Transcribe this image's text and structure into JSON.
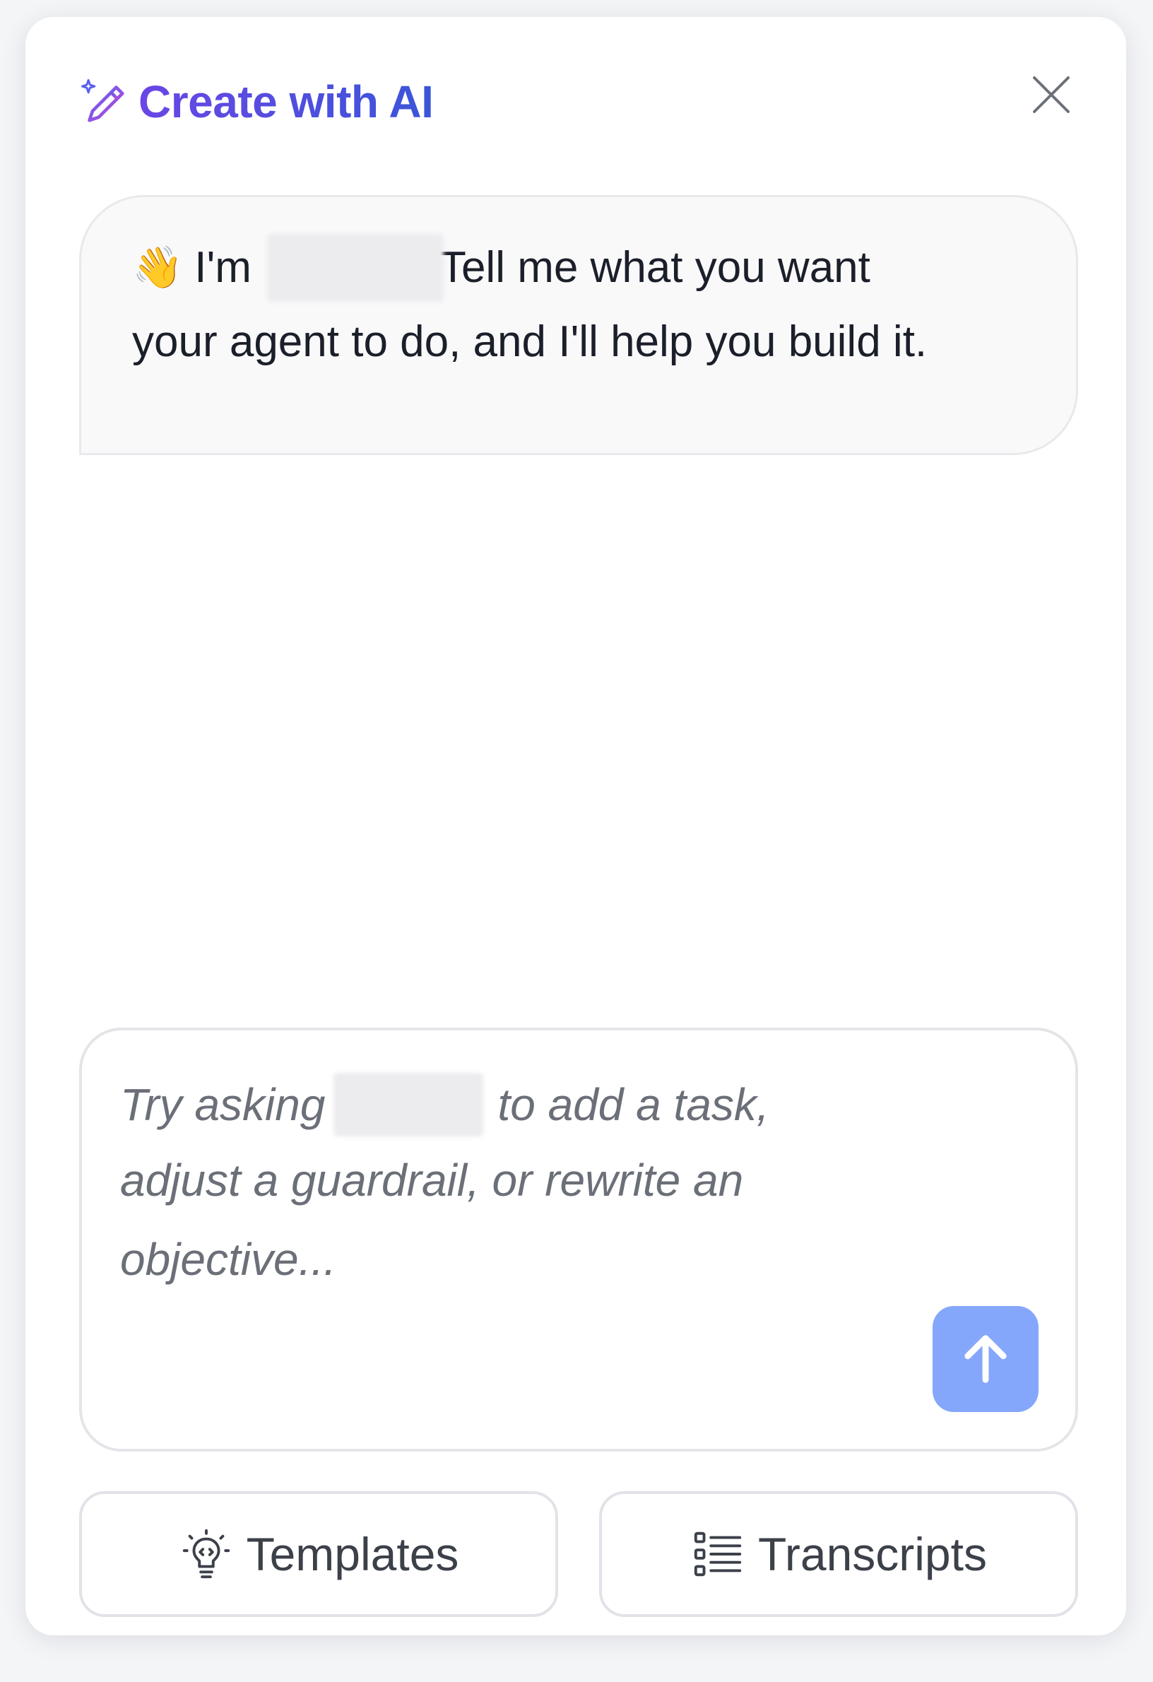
{
  "header": {
    "title": "Create with AI",
    "icon": "magic-pen-icon",
    "close_icon": "close-icon"
  },
  "chat": {
    "assistant_message": {
      "emoji": "👋",
      "prefix": "I'm",
      "name_redacted": true,
      "line1_rest": "Tell me what you want",
      "line2": "your agent to do, and I'll help you build it."
    }
  },
  "composer": {
    "placeholder_line1_start": "Try asking",
    "placeholder_line1_end": "to add a task,",
    "placeholder_line2": "adjust a guardrail, or rewrite an",
    "placeholder_line3": "objective...",
    "send_icon": "arrow-up-icon"
  },
  "actions": {
    "templates_label": "Templates",
    "templates_icon": "lightbulb-icon",
    "transcripts_label": "Transcripts",
    "transcripts_icon": "list-icon"
  },
  "colors": {
    "title_gradient_start": "#6a46e6",
    "title_gradient_end": "#3a55d8",
    "send_button": "#85a7fb",
    "bubble_bg": "#f9f9fa"
  }
}
